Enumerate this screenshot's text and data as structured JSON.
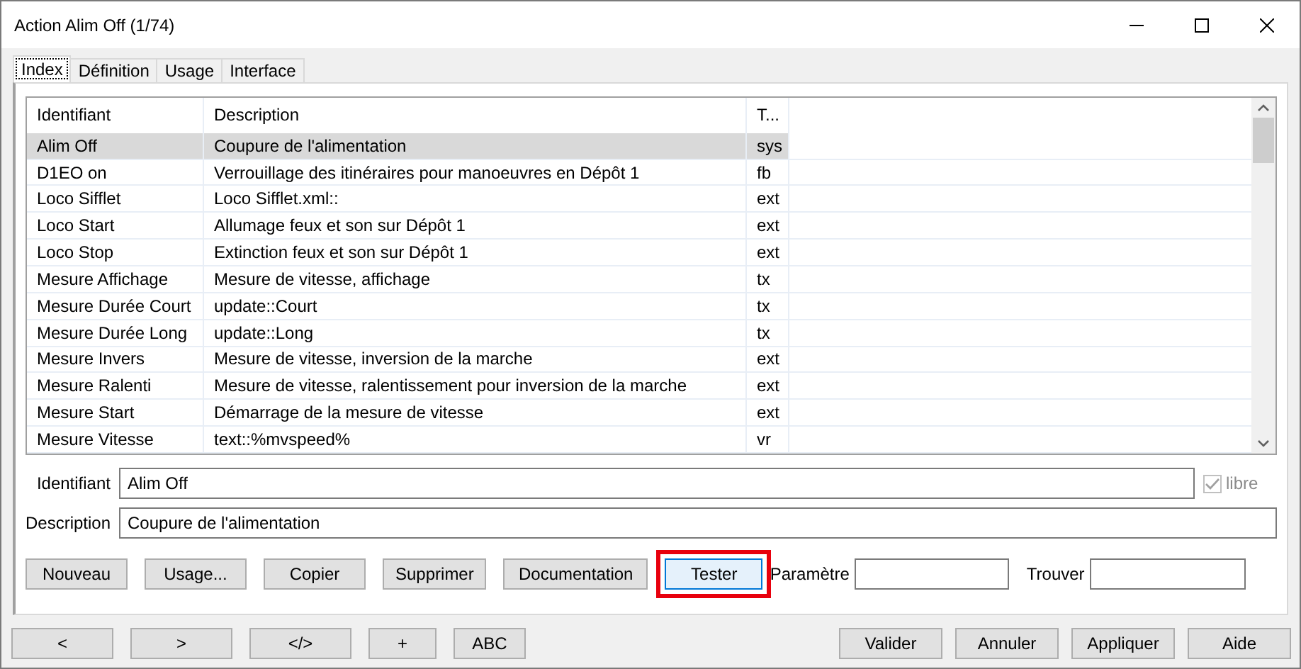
{
  "window": {
    "title": "Action Alim Off (1/74)"
  },
  "tabs": [
    {
      "label": "Index",
      "selected": true
    },
    {
      "label": "Définition",
      "selected": false
    },
    {
      "label": "Usage",
      "selected": false
    },
    {
      "label": "Interface",
      "selected": false
    }
  ],
  "table": {
    "columns": [
      "Identifiant",
      "Description",
      "T..."
    ],
    "rows": [
      {
        "cells": [
          "Alim Off",
          "Coupure de l'alimentation",
          "sys"
        ],
        "selected": true
      },
      {
        "cells": [
          "D1EO on",
          "Verrouillage des itinéraires pour manoeuvres en Dépôt 1",
          "fb"
        ],
        "selected": false
      },
      {
        "cells": [
          "Loco Sifflet",
          "Loco Sifflet.xml::",
          "ext"
        ],
        "selected": false
      },
      {
        "cells": [
          "Loco Start",
          "Allumage feux et son sur Dépôt 1",
          "ext"
        ],
        "selected": false
      },
      {
        "cells": [
          "Loco Stop",
          "Extinction feux et son sur Dépôt 1",
          "ext"
        ],
        "selected": false
      },
      {
        "cells": [
          "Mesure Affichage",
          "Mesure de vitesse, affichage",
          "tx"
        ],
        "selected": false
      },
      {
        "cells": [
          "Mesure Durée Court",
          "update::Court",
          "tx"
        ],
        "selected": false
      },
      {
        "cells": [
          "Mesure Durée Long",
          "update::Long",
          "tx"
        ],
        "selected": false
      },
      {
        "cells": [
          "Mesure Invers",
          "Mesure de vitesse, inversion de la marche",
          "ext"
        ],
        "selected": false
      },
      {
        "cells": [
          "Mesure Ralenti",
          "Mesure de vitesse, ralentissement pour inversion de la marche",
          "ext"
        ],
        "selected": false
      },
      {
        "cells": [
          "Mesure Start",
          "Démarrage de la mesure de vitesse",
          "ext"
        ],
        "selected": false
      },
      {
        "cells": [
          "Mesure Vitesse",
          "text::%mvspeed%",
          "vr"
        ],
        "selected": false
      }
    ]
  },
  "form": {
    "identifiant": {
      "label": "Identifiant",
      "value": "Alim Off"
    },
    "libre": {
      "label": "libre",
      "checked": true,
      "disabled": true
    },
    "description": {
      "label": "Description",
      "value": "Coupure de l'alimentation"
    }
  },
  "actions": [
    {
      "label": "Nouveau",
      "highlighted": false
    },
    {
      "label": "Usage...",
      "highlighted": false
    },
    {
      "label": "Copier",
      "highlighted": false
    },
    {
      "label": "Supprimer",
      "highlighted": false
    },
    {
      "label": "Documentation",
      "highlighted": false
    },
    {
      "label": "Tester",
      "highlighted": true
    }
  ],
  "parametre": {
    "label": "Paramètre"
  },
  "trouver": {
    "label": "Trouver"
  },
  "footer_left": [
    "<",
    ">",
    "</>",
    "+",
    "ABC"
  ],
  "footer_right": [
    "Valider",
    "Annuler",
    "Appliquer",
    "Aide"
  ]
}
